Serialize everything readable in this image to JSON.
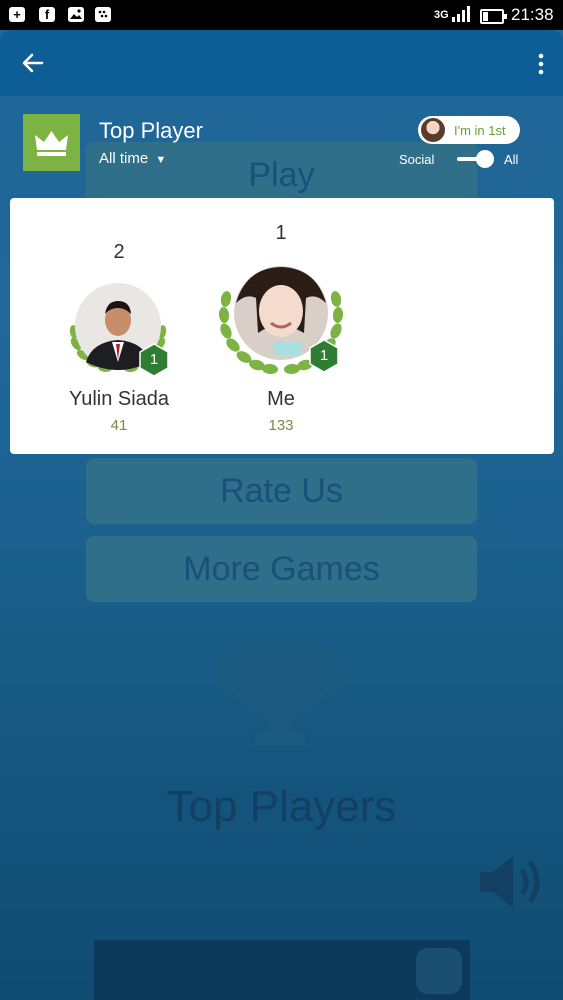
{
  "status_bar": {
    "network": "3G",
    "time": "21:38",
    "icons": [
      "add-box-icon",
      "facebook-icon",
      "image-icon",
      "bbm-icon",
      "signal-icon",
      "battery-icon"
    ]
  },
  "background_menu": {
    "buttons": [
      "Play",
      "Rate Us",
      "More Games"
    ],
    "title": "Top Players"
  },
  "leaderboard": {
    "title": "Top Player",
    "time_span": "All time",
    "position_badge": "I'm in 1st",
    "toggle": {
      "left_label": "Social",
      "right_label": "All",
      "selected": "All"
    },
    "players": [
      {
        "rank": "2",
        "name": "Yulin Siada",
        "score": "41",
        "level": "1"
      },
      {
        "rank": "1",
        "name": "Me",
        "score": "133",
        "level": "1"
      }
    ]
  },
  "colors": {
    "accent_green": "#7cb342",
    "level_badge": "#2e7d32",
    "score_text": "#7a8b45"
  }
}
